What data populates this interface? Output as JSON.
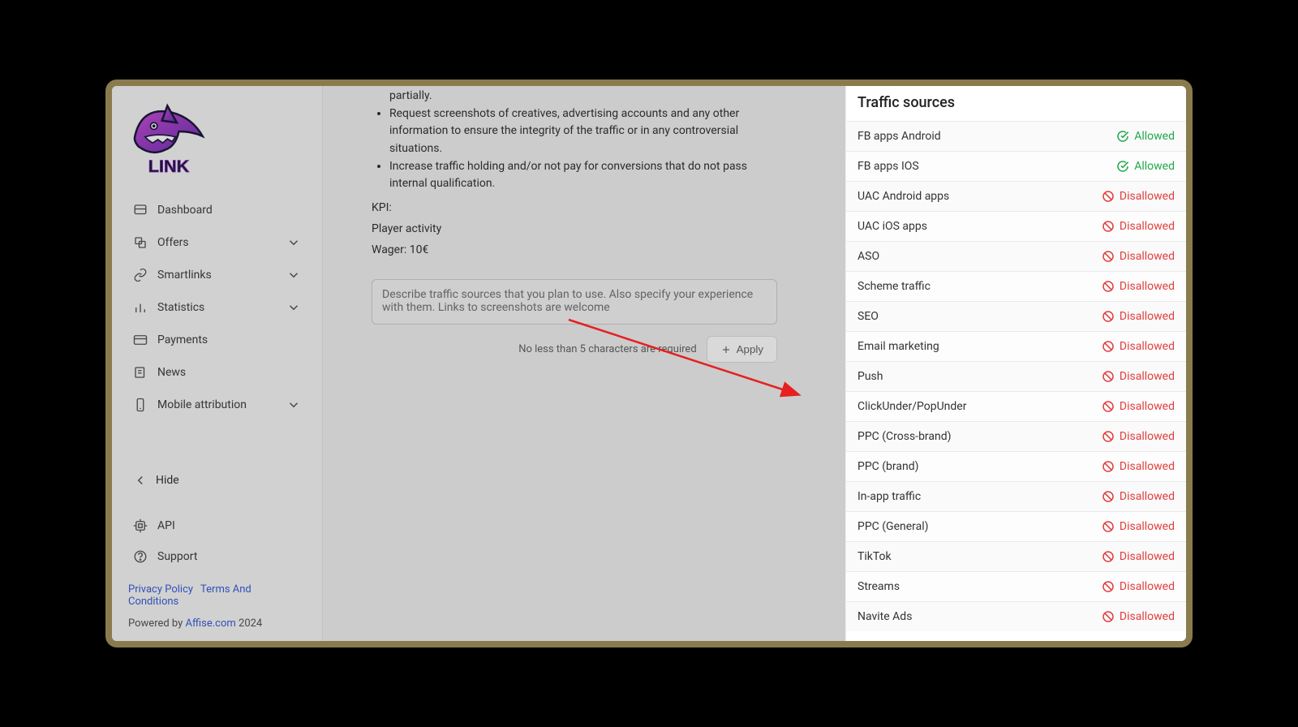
{
  "sidebar": {
    "nav": [
      {
        "label": "Dashboard",
        "icon": "dashboard-icon",
        "expandable": false
      },
      {
        "label": "Offers",
        "icon": "offers-icon",
        "expandable": true
      },
      {
        "label": "Smartlinks",
        "icon": "link-icon",
        "expandable": true
      },
      {
        "label": "Statistics",
        "icon": "stats-icon",
        "expandable": true
      },
      {
        "label": "Payments",
        "icon": "card-icon",
        "expandable": false
      },
      {
        "label": "News",
        "icon": "news-icon",
        "expandable": false
      },
      {
        "label": "Mobile attribution",
        "icon": "mobile-icon",
        "expandable": true
      }
    ],
    "hide": "Hide",
    "api": "API",
    "support": "Support",
    "privacy": "Privacy Policy",
    "terms": "Terms And Conditions",
    "powered_by": "Powered by ",
    "powered_link": "Affise.com",
    "year": "2024"
  },
  "main": {
    "bullets": [
      "partially.",
      "Request screenshots of creatives, advertising accounts and any other information to ensure the integrity of the traffic or in any controversial situations.",
      "Increase traffic holding and/or not pay for conversions that do not pass internal qualification."
    ],
    "kpi_label": "KPI:",
    "kpi_activity": "Player activity",
    "kpi_wager": "Wager: 10€",
    "textarea_placeholder": "Describe traffic sources that you plan to use. Also specify your experience with them. Links to screenshots are welcome",
    "req_text": "No less than 5 characters are required",
    "apply_label": "Apply"
  },
  "panel": {
    "title": "Traffic sources",
    "allowed_label": "Allowed",
    "disallowed_label": "Disallowed",
    "items": [
      {
        "name": "FB apps Android",
        "status": "allowed"
      },
      {
        "name": "FB apps IOS",
        "status": "allowed"
      },
      {
        "name": "UAC Android apps",
        "status": "disallowed"
      },
      {
        "name": "UAC iOS apps",
        "status": "disallowed"
      },
      {
        "name": "ASO",
        "status": "disallowed"
      },
      {
        "name": "Scheme traffic",
        "status": "disallowed"
      },
      {
        "name": "SEO",
        "status": "disallowed"
      },
      {
        "name": "Email marketing",
        "status": "disallowed"
      },
      {
        "name": "Push",
        "status": "disallowed"
      },
      {
        "name": "ClickUnder/PopUnder",
        "status": "disallowed"
      },
      {
        "name": "PPC (Cross-brand)",
        "status": "disallowed"
      },
      {
        "name": "PPC (brand)",
        "status": "disallowed"
      },
      {
        "name": "In-app traffic",
        "status": "disallowed"
      },
      {
        "name": "PPC (General)",
        "status": "disallowed"
      },
      {
        "name": "TikTok",
        "status": "disallowed"
      },
      {
        "name": "Streams",
        "status": "disallowed"
      },
      {
        "name": "Navite Ads",
        "status": "disallowed"
      }
    ]
  }
}
